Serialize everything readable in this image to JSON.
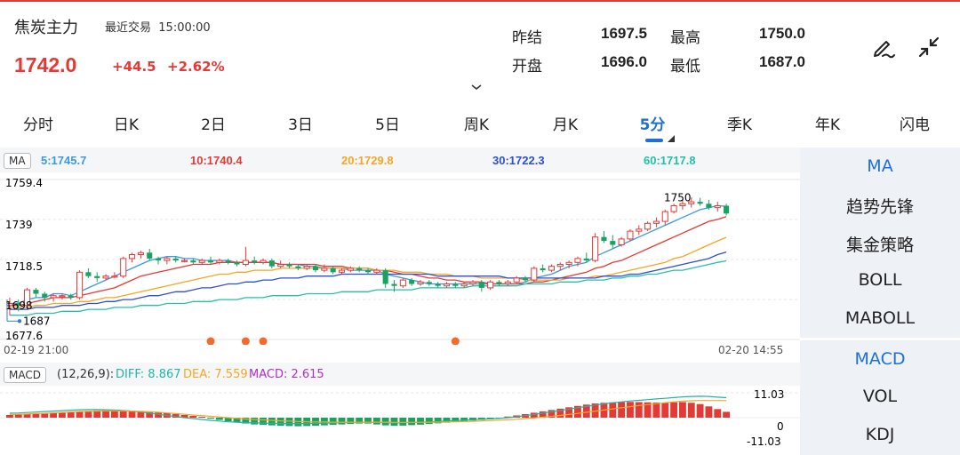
{
  "header": {
    "name": "焦炭主力",
    "recent_label": "最近交易",
    "recent_time": "15:00:00",
    "price": "1742.0",
    "change": "+44.5",
    "change_pct": "+2.62%"
  },
  "quote": {
    "prev_settle_label": "昨结",
    "prev_settle": "1697.5",
    "high_label": "最高",
    "high": "1750.0",
    "open_label": "开盘",
    "open": "1696.0",
    "low_label": "最低",
    "low": "1687.0"
  },
  "icons": {
    "draw": "pen-draw-icon",
    "collapse": "collapse-arrows-icon",
    "expand": "chevron-down-icon"
  },
  "tabs": [
    "分时",
    "日K",
    "2日",
    "3日",
    "5日",
    "周K",
    "月K",
    "5分",
    "季K",
    "年K",
    "闪电"
  ],
  "active_tab": "5分",
  "ma_legend": {
    "badge": "MA",
    "items": [
      {
        "label": "5:1745.7",
        "color": "#3a9bdc"
      },
      {
        "label": "10:1740.4",
        "color": "#e53935"
      },
      {
        "label": "20:1729.8",
        "color": "#f5a623"
      },
      {
        "label": "30:1722.3",
        "color": "#2d4fd6"
      },
      {
        "label": "60:1717.8",
        "color": "#26c0a8"
      }
    ]
  },
  "macd_legend": {
    "badge": "MACD",
    "params": "(12,26,9):",
    "diff": "DIFF: 8.867",
    "dea": "DEA: 7.559",
    "macd": "MACD: 2.615"
  },
  "sidebar": {
    "main_indicators": [
      "MA",
      "趋势先锋",
      "集金策略",
      "BOLL",
      "MABOLL"
    ],
    "sub_indicators": [
      "MACD",
      "VOL",
      "KDJ"
    ]
  },
  "colors": {
    "up": "#e53935",
    "down": "#1aa260",
    "accent": "#1e6fd9"
  },
  "chart_data": {
    "type": "candlestick",
    "y_axis_labels": [
      "1759.4",
      "1739",
      "1718.5",
      "1698",
      "1677.6"
    ],
    "ylim": [
      1677.6,
      1759.4
    ],
    "high_annotation": "1750",
    "low_annotation": "1687",
    "x_start_label": "02-19 21:00",
    "x_end_label": "02-20 14:55",
    "candles": [
      [
        1695,
        1699,
        1690,
        1696
      ],
      [
        1696,
        1698,
        1692,
        1695
      ],
      [
        1695,
        1704,
        1694,
        1703
      ],
      [
        1703,
        1704,
        1699,
        1701
      ],
      [
        1701,
        1702,
        1697,
        1699
      ],
      [
        1699,
        1701,
        1697,
        1700
      ],
      [
        1700,
        1701,
        1698,
        1700
      ],
      [
        1700,
        1701,
        1698,
        1699
      ],
      [
        1699,
        1713,
        1698,
        1712
      ],
      [
        1712,
        1714,
        1709,
        1710
      ],
      [
        1710,
        1712,
        1707,
        1709
      ],
      [
        1709,
        1711,
        1708,
        1710
      ],
      [
        1710,
        1712,
        1709,
        1710
      ],
      [
        1710,
        1720,
        1709,
        1719
      ],
      [
        1719,
        1722,
        1717,
        1721
      ],
      [
        1721,
        1723,
        1719,
        1722
      ],
      [
        1722,
        1724,
        1718,
        1719
      ],
      [
        1719,
        1720,
        1716,
        1718
      ],
      [
        1718,
        1720,
        1716,
        1719
      ],
      [
        1719,
        1720,
        1717,
        1718
      ],
      [
        1718,
        1719,
        1717,
        1718
      ],
      [
        1718,
        1719,
        1716,
        1717
      ],
      [
        1717,
        1719,
        1716,
        1718
      ],
      [
        1718,
        1720,
        1716,
        1717
      ],
      [
        1717,
        1719,
        1716,
        1718
      ],
      [
        1718,
        1719,
        1716,
        1717
      ],
      [
        1717,
        1718,
        1715,
        1716
      ],
      [
        1716,
        1725,
        1715,
        1718
      ],
      [
        1718,
        1720,
        1716,
        1717
      ],
      [
        1717,
        1719,
        1716,
        1718
      ],
      [
        1718,
        1719,
        1714,
        1715
      ],
      [
        1715,
        1718,
        1714,
        1716
      ],
      [
        1716,
        1717,
        1714,
        1715
      ],
      [
        1715,
        1716,
        1713,
        1714
      ],
      [
        1714,
        1716,
        1713,
        1715
      ],
      [
        1715,
        1716,
        1712,
        1713
      ],
      [
        1713,
        1716,
        1712,
        1714
      ],
      [
        1714,
        1715,
        1711,
        1712
      ],
      [
        1712,
        1714,
        1711,
        1713
      ],
      [
        1713,
        1715,
        1712,
        1714
      ],
      [
        1714,
        1715,
        1712,
        1713
      ],
      [
        1713,
        1714,
        1711,
        1712
      ],
      [
        1712,
        1714,
        1711,
        1713
      ],
      [
        1713,
        1714,
        1704,
        1706
      ],
      [
        1706,
        1708,
        1702,
        1705
      ],
      [
        1705,
        1709,
        1704,
        1708
      ],
      [
        1708,
        1709,
        1705,
        1706
      ],
      [
        1706,
        1708,
        1705,
        1707
      ],
      [
        1707,
        1708,
        1705,
        1706
      ],
      [
        1706,
        1707,
        1704,
        1705
      ],
      [
        1705,
        1707,
        1704,
        1706
      ],
      [
        1706,
        1707,
        1704,
        1705
      ],
      [
        1705,
        1707,
        1704,
        1706
      ],
      [
        1706,
        1708,
        1705,
        1707
      ],
      [
        1707,
        1708,
        1702,
        1704
      ],
      [
        1704,
        1708,
        1703,
        1707
      ],
      [
        1707,
        1708,
        1705,
        1706
      ],
      [
        1706,
        1708,
        1705,
        1707
      ],
      [
        1707,
        1710,
        1706,
        1709
      ],
      [
        1709,
        1710,
        1707,
        1708
      ],
      [
        1708,
        1715,
        1707,
        1714
      ],
      [
        1714,
        1716,
        1712,
        1713
      ],
      [
        1713,
        1716,
        1712,
        1715
      ],
      [
        1715,
        1717,
        1713,
        1716
      ],
      [
        1716,
        1718,
        1714,
        1717
      ],
      [
        1717,
        1720,
        1715,
        1719
      ],
      [
        1719,
        1722,
        1717,
        1718
      ],
      [
        1718,
        1732,
        1717,
        1730
      ],
      [
        1730,
        1733,
        1727,
        1728
      ],
      [
        1728,
        1731,
        1724,
        1726
      ],
      [
        1726,
        1730,
        1725,
        1729
      ],
      [
        1729,
        1734,
        1728,
        1733
      ],
      [
        1733,
        1736,
        1731,
        1734
      ],
      [
        1734,
        1738,
        1733,
        1737
      ],
      [
        1737,
        1740,
        1735,
        1738
      ],
      [
        1738,
        1744,
        1736,
        1743
      ],
      [
        1743,
        1747,
        1742,
        1746
      ],
      [
        1746,
        1749,
        1744,
        1747
      ],
      [
        1747,
        1750,
        1745,
        1748
      ],
      [
        1748,
        1750,
        1746,
        1747
      ],
      [
        1747,
        1749,
        1744,
        1745
      ],
      [
        1745,
        1748,
        1743,
        1746
      ],
      [
        1746,
        1747,
        1741,
        1742
      ]
    ],
    "ma": {
      "5": [
        1696,
        1696,
        1698,
        1699,
        1699,
        1701,
        1701,
        1700,
        1702,
        1704,
        1706,
        1708,
        1710,
        1712,
        1714,
        1716,
        1718,
        1719,
        1720,
        1720,
        1719,
        1719,
        1718,
        1718,
        1718,
        1718,
        1717,
        1717,
        1717,
        1717,
        1717,
        1716,
        1716,
        1716,
        1715,
        1715,
        1714,
        1714,
        1714,
        1713,
        1713,
        1713,
        1713,
        1711,
        1710,
        1709,
        1708,
        1707,
        1706,
        1706,
        1706,
        1706,
        1706,
        1706,
        1706,
        1706,
        1706,
        1706,
        1706,
        1707,
        1709,
        1710,
        1711,
        1713,
        1715,
        1716,
        1717,
        1720,
        1722,
        1724,
        1726,
        1728,
        1730,
        1732,
        1734,
        1736,
        1738,
        1740,
        1742,
        1744,
        1745,
        1746,
        1745.7
      ],
      "10": [
        1695,
        1695,
        1696,
        1697,
        1698,
        1699,
        1699,
        1699,
        1700,
        1701,
        1702,
        1703,
        1704,
        1706,
        1708,
        1710,
        1711,
        1712,
        1713,
        1714,
        1715,
        1716,
        1716,
        1716,
        1717,
        1717,
        1717,
        1717,
        1717,
        1717,
        1717,
        1716,
        1716,
        1716,
        1716,
        1716,
        1715,
        1715,
        1715,
        1714,
        1714,
        1714,
        1713,
        1713,
        1712,
        1711,
        1711,
        1710,
        1709,
        1709,
        1708,
        1708,
        1707,
        1707,
        1707,
        1706,
        1706,
        1706,
        1706,
        1706,
        1707,
        1707,
        1708,
        1709,
        1710,
        1711,
        1712,
        1714,
        1715,
        1717,
        1718,
        1720,
        1722,
        1724,
        1726,
        1728,
        1730,
        1732,
        1734,
        1736,
        1738,
        1739,
        1740.4
      ],
      "20": [
        1694,
        1694,
        1694,
        1695,
        1695,
        1696,
        1696,
        1696,
        1697,
        1697,
        1698,
        1699,
        1699,
        1700,
        1701,
        1702,
        1703,
        1704,
        1705,
        1706,
        1707,
        1708,
        1709,
        1710,
        1711,
        1711,
        1712,
        1712,
        1713,
        1713,
        1713,
        1714,
        1714,
        1714,
        1714,
        1714,
        1714,
        1714,
        1714,
        1714,
        1714,
        1714,
        1713,
        1713,
        1713,
        1712,
        1712,
        1712,
        1711,
        1711,
        1711,
        1710,
        1710,
        1710,
        1709,
        1709,
        1709,
        1709,
        1709,
        1708,
        1708,
        1708,
        1708,
        1708,
        1709,
        1709,
        1709,
        1710,
        1710,
        1711,
        1712,
        1713,
        1714,
        1715,
        1716,
        1717,
        1719,
        1720,
        1722,
        1724,
        1726,
        1728,
        1729.8
      ],
      "30": [
        1693,
        1693,
        1693,
        1694,
        1694,
        1694,
        1695,
        1695,
        1695,
        1696,
        1696,
        1697,
        1697,
        1698,
        1698,
        1699,
        1700,
        1700,
        1701,
        1702,
        1702,
        1703,
        1704,
        1704,
        1705,
        1706,
        1706,
        1707,
        1707,
        1708,
        1708,
        1709,
        1709,
        1709,
        1710,
        1710,
        1710,
        1710,
        1711,
        1711,
        1711,
        1711,
        1711,
        1711,
        1711,
        1711,
        1711,
        1711,
        1711,
        1710,
        1710,
        1710,
        1710,
        1710,
        1710,
        1710,
        1710,
        1709,
        1709,
        1709,
        1709,
        1709,
        1709,
        1709,
        1709,
        1709,
        1709,
        1709,
        1710,
        1710,
        1710,
        1711,
        1711,
        1712,
        1713,
        1714,
        1715,
        1716,
        1717,
        1718,
        1719,
        1721,
        1722.3
      ],
      "60": [
        1690,
        1690,
        1690,
        1691,
        1691,
        1691,
        1692,
        1692,
        1692,
        1693,
        1693,
        1693,
        1694,
        1694,
        1694,
        1695,
        1695,
        1695,
        1696,
        1696,
        1696,
        1697,
        1697,
        1697,
        1698,
        1698,
        1698,
        1699,
        1699,
        1699,
        1700,
        1700,
        1700,
        1700,
        1701,
        1701,
        1701,
        1701,
        1702,
        1702,
        1702,
        1702,
        1703,
        1703,
        1703,
        1703,
        1703,
        1704,
        1704,
        1704,
        1704,
        1704,
        1704,
        1705,
        1705,
        1705,
        1705,
        1705,
        1705,
        1706,
        1706,
        1706,
        1706,
        1707,
        1707,
        1707,
        1708,
        1708,
        1708,
        1709,
        1709,
        1710,
        1710,
        1711,
        1711,
        1712,
        1713,
        1713,
        1714,
        1715,
        1716,
        1717,
        1717.8
      ]
    },
    "signal_dots_at": [
      23,
      27,
      29,
      51
    ],
    "macd": {
      "axis_labels": [
        "11.03",
        "0",
        "-11.03"
      ],
      "ylim": [
        -11.03,
        11.03
      ],
      "hist": [
        1.2,
        1.4,
        1.6,
        1.8,
        2.0,
        2.2,
        2.4,
        2.6,
        2.8,
        3.0,
        3.2,
        3.3,
        3.3,
        3.2,
        3.0,
        2.8,
        2.6,
        2.3,
        2.0,
        1.6,
        1.2,
        0.8,
        0.4,
        -0.4,
        -1.0,
        -1.6,
        -2.2,
        -2.6,
        -3.0,
        -3.2,
        -3.4,
        -3.6,
        -3.7,
        -3.8,
        -3.7,
        -3.6,
        -3.4,
        -3.2,
        -3.0,
        -2.8,
        -2.6,
        -2.6,
        -3.0,
        -3.4,
        -3.6,
        -3.5,
        -3.3,
        -3.1,
        -2.8,
        -2.5,
        -2.2,
        -1.9,
        -1.6,
        -1.3,
        -1.0,
        -0.7,
        -0.4,
        0.5,
        1.0,
        1.6,
        2.2,
        2.8,
        3.4,
        4.0,
        4.6,
        5.2,
        5.8,
        6.3,
        6.6,
        6.8,
        6.9,
        7.0,
        6.9,
        6.8,
        6.7,
        6.6,
        6.8,
        6.9,
        6.6,
        6.0,
        5.0,
        3.8,
        2.6
      ],
      "diff": [
        2.0,
        2.1,
        2.3,
        2.5,
        2.7,
        2.9,
        3.1,
        3.3,
        3.5,
        3.6,
        3.6,
        3.5,
        3.4,
        3.2,
        2.9,
        2.5,
        2.0,
        1.5,
        1.0,
        0.5,
        0.0,
        -0.4,
        -0.8,
        -1.2,
        -1.5,
        -1.8,
        -2.0,
        -2.2,
        -2.3,
        -2.4,
        -2.5,
        -2.6,
        -2.6,
        -2.6,
        -2.6,
        -2.5,
        -2.4,
        -2.3,
        -2.2,
        -2.1,
        -2.0,
        -2.0,
        -2.1,
        -2.2,
        -2.3,
        -2.2,
        -2.1,
        -2.0,
        -1.9,
        -1.7,
        -1.5,
        -1.3,
        -1.1,
        -0.9,
        -0.7,
        -0.5,
        -0.3,
        0.0,
        0.4,
        0.9,
        1.4,
        2.0,
        2.6,
        3.2,
        3.8,
        4.4,
        5.0,
        5.6,
        6.1,
        6.6,
        7.0,
        7.4,
        7.7,
        8.0,
        8.3,
        8.6,
        8.9,
        9.2,
        9.4,
        9.5,
        9.4,
        9.1,
        8.867
      ],
      "dea": [
        1.4,
        1.5,
        1.6,
        1.8,
        1.9,
        2.1,
        2.3,
        2.5,
        2.7,
        2.8,
        2.9,
        3.0,
        3.0,
        3.0,
        2.9,
        2.8,
        2.6,
        2.4,
        2.1,
        1.8,
        1.5,
        1.2,
        0.9,
        0.6,
        0.3,
        0.0,
        -0.3,
        -0.6,
        -0.8,
        -1.0,
        -1.2,
        -1.4,
        -1.5,
        -1.7,
        -1.8,
        -1.9,
        -1.9,
        -2.0,
        -2.0,
        -2.0,
        -2.0,
        -2.0,
        -2.0,
        -2.0,
        -2.1,
        -2.1,
        -2.1,
        -2.1,
        -2.0,
        -2.0,
        -1.9,
        -1.8,
        -1.7,
        -1.6,
        -1.4,
        -1.3,
        -1.1,
        -0.9,
        -0.7,
        -0.4,
        -0.1,
        0.2,
        0.6,
        1.0,
        1.4,
        1.9,
        2.4,
        2.9,
        3.4,
        3.9,
        4.4,
        4.9,
        5.4,
        5.8,
        6.2,
        6.6,
        7.0,
        7.3,
        7.5,
        7.6,
        7.6,
        7.6,
        7.559
      ]
    }
  }
}
